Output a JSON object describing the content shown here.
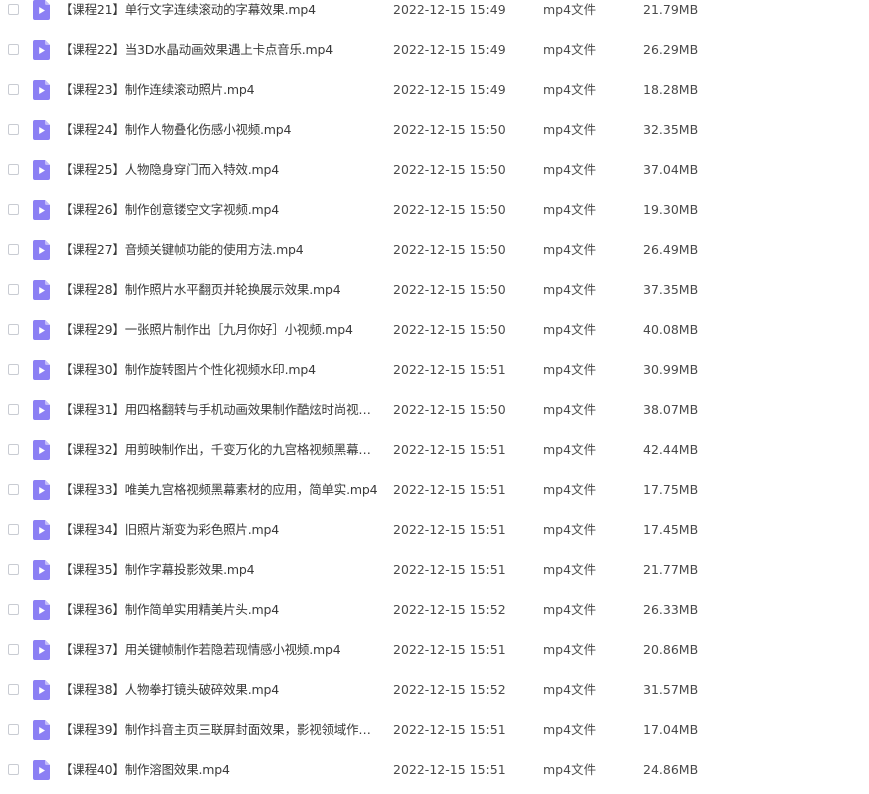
{
  "files": [
    {
      "name": "【课程21】单行文字连续滚动的字幕效果.mp4",
      "date": "2022-12-15 15:49",
      "type": "mp4文件",
      "size": "21.79MB"
    },
    {
      "name": "【课程22】当3D水晶动画效果遇上卡点音乐.mp4",
      "date": "2022-12-15 15:49",
      "type": "mp4文件",
      "size": "26.29MB"
    },
    {
      "name": "【课程23】制作连续滚动照片.mp4",
      "date": "2022-12-15 15:49",
      "type": "mp4文件",
      "size": "18.28MB"
    },
    {
      "name": "【课程24】制作人物叠化伤感小视频.mp4",
      "date": "2022-12-15 15:50",
      "type": "mp4文件",
      "size": "32.35MB"
    },
    {
      "name": "【课程25】人物隐身穿门而入特效.mp4",
      "date": "2022-12-15 15:50",
      "type": "mp4文件",
      "size": "37.04MB"
    },
    {
      "name": "【课程26】制作创意镂空文字视频.mp4",
      "date": "2022-12-15 15:50",
      "type": "mp4文件",
      "size": "19.30MB"
    },
    {
      "name": "【课程27】音频关键帧功能的使用方法.mp4",
      "date": "2022-12-15 15:50",
      "type": "mp4文件",
      "size": "26.49MB"
    },
    {
      "name": "【课程28】制作照片水平翻页并轮换展示效果.mp4",
      "date": "2022-12-15 15:50",
      "type": "mp4文件",
      "size": "37.35MB"
    },
    {
      "name": "【课程29】一张照片制作出［九月你好］小视频.mp4",
      "date": "2022-12-15 15:50",
      "type": "mp4文件",
      "size": "40.08MB"
    },
    {
      "name": "【课程30】制作旋转图片个性化视频水印.mp4",
      "date": "2022-12-15 15:51",
      "type": "mp4文件",
      "size": "30.99MB"
    },
    {
      "name": "【课程31】用四格翻转与手机动画效果制作酷炫时尚视频...",
      "date": "2022-12-15 15:50",
      "type": "mp4文件",
      "size": "38.07MB"
    },
    {
      "name": "【课程32】用剪映制作出，千变万化的九宫格视频黑幕素...",
      "date": "2022-12-15 15:51",
      "type": "mp4文件",
      "size": "42.44MB"
    },
    {
      "name": "【课程33】唯美九宫格视频黑幕素材的应用，简单实.mp4",
      "date": "2022-12-15 15:51",
      "type": "mp4文件",
      "size": "17.75MB"
    },
    {
      "name": "【课程34】旧照片渐变为彩色照片.mp4",
      "date": "2022-12-15 15:51",
      "type": "mp4文件",
      "size": "17.45MB"
    },
    {
      "name": "【课程35】制作字幕投影效果.mp4",
      "date": "2022-12-15 15:51",
      "type": "mp4文件",
      "size": "21.77MB"
    },
    {
      "name": "【课程36】制作简单实用精美片头.mp4",
      "date": "2022-12-15 15:52",
      "type": "mp4文件",
      "size": "26.33MB"
    },
    {
      "name": "【课程37】用关键帧制作若隐若现情感小视频.mp4",
      "date": "2022-12-15 15:51",
      "type": "mp4文件",
      "size": "20.86MB"
    },
    {
      "name": "【课程38】人物拳打镜头破碎效果.mp4",
      "date": "2022-12-15 15:52",
      "type": "mp4文件",
      "size": "31.57MB"
    },
    {
      "name": "【课程39】制作抖音主页三联屏封面效果，影视领域作者...",
      "date": "2022-12-15 15:51",
      "type": "mp4文件",
      "size": "17.04MB"
    },
    {
      "name": "【课程40】制作溶图效果.mp4",
      "date": "2022-12-15 15:51",
      "type": "mp4文件",
      "size": "24.86MB"
    }
  ],
  "icons": {
    "row_icon": "video-file-icon",
    "icon_color": "#8b7ff4"
  }
}
